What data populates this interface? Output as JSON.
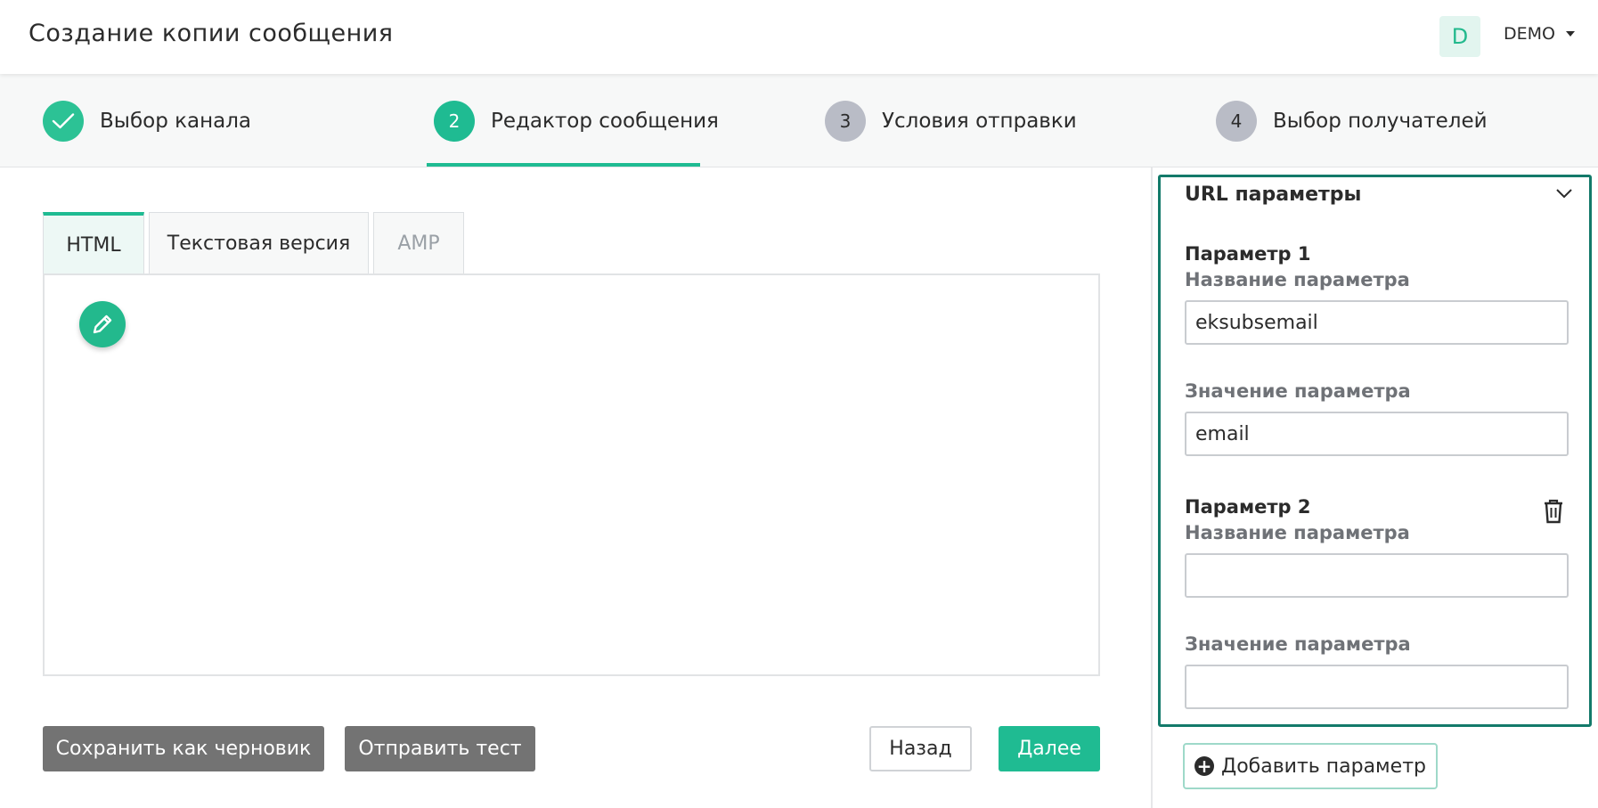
{
  "header": {
    "title": "Создание копии сообщения",
    "avatar_initial": "D",
    "user_name": "DEMO",
    "colors": {
      "accent": "#1fbb92",
      "avatar_bg": "#e2f5ef"
    }
  },
  "stepper": {
    "steps": [
      {
        "number": "",
        "label": "Выбор канала",
        "state": "done"
      },
      {
        "number": "2",
        "label": "Редактор сообщения",
        "state": "active"
      },
      {
        "number": "3",
        "label": "Условия отправки",
        "state": "todo"
      },
      {
        "number": "4",
        "label": "Выбор получателей",
        "state": "todo"
      }
    ]
  },
  "editor": {
    "tabs": [
      {
        "label": "HTML",
        "state": "active"
      },
      {
        "label": "Текстовая версия",
        "state": "normal"
      },
      {
        "label": "AMP",
        "state": "disabled"
      }
    ],
    "edit_icon": "pencil-icon"
  },
  "actions": {
    "save_draft": "Сохранить как черновик",
    "send_test": "Отправить тест",
    "back": "Назад",
    "next": "Далее"
  },
  "url_params": {
    "title": "URL параметры",
    "params": [
      {
        "heading": "Параметр 1",
        "name_label": "Название параметра",
        "name_value": "eksubsemail",
        "value_label": "Значение параметра",
        "value_value": "email"
      },
      {
        "heading": "Параметр 2",
        "name_label": "Название параметра",
        "name_value": "",
        "value_label": "Значение параметра",
        "value_value": ""
      }
    ],
    "add_label": "Добавить параметр",
    "colors": {
      "border": "#137a6a"
    }
  }
}
